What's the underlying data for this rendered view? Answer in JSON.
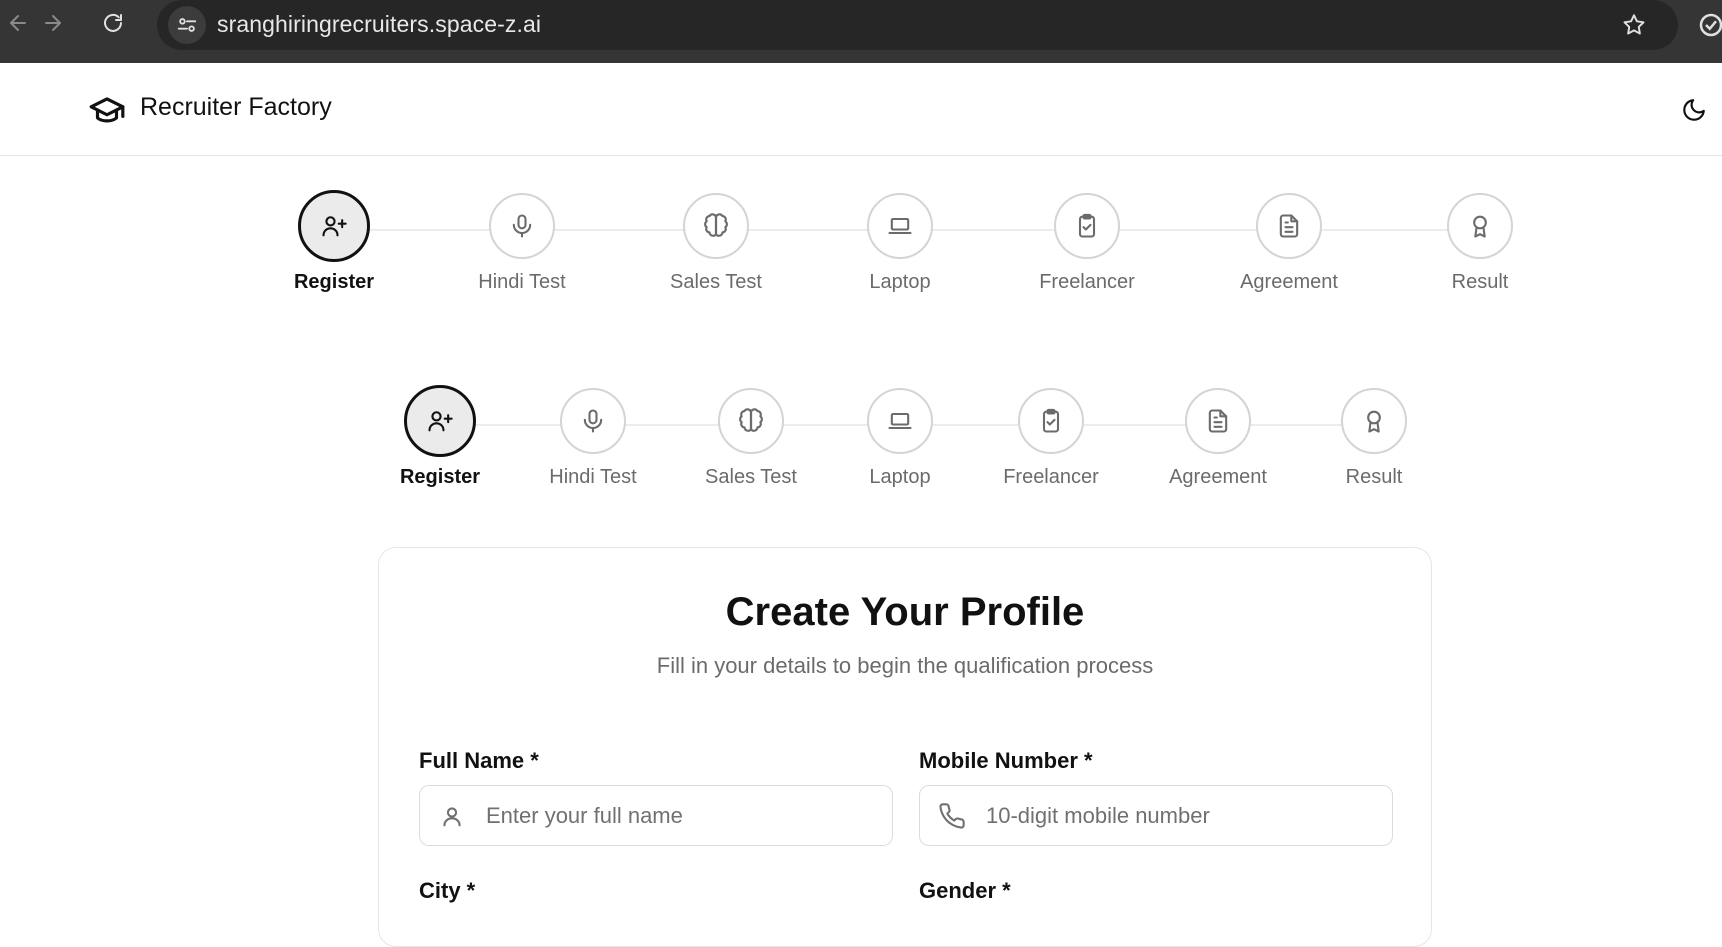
{
  "browser": {
    "url": "sranghiringrecruiters.space-z.ai"
  },
  "header": {
    "brand_name": "Recruiter Factory"
  },
  "stepper": {
    "active_index": 0,
    "steps": [
      {
        "label": "Register",
        "icon": "user-plus-icon"
      },
      {
        "label": "Hindi Test",
        "icon": "microphone-icon"
      },
      {
        "label": "Sales Test",
        "icon": "brain-icon"
      },
      {
        "label": "Laptop",
        "icon": "laptop-icon"
      },
      {
        "label": "Freelancer",
        "icon": "clipboard-check-icon"
      },
      {
        "label": "Agreement",
        "icon": "document-icon"
      },
      {
        "label": "Result",
        "icon": "award-icon"
      }
    ]
  },
  "form": {
    "title": "Create Your Profile",
    "subtitle": "Fill in your details to begin the qualification process",
    "full_name": {
      "label": "Full Name *",
      "placeholder": "Enter your full name",
      "value": ""
    },
    "mobile": {
      "label": "Mobile Number *",
      "placeholder": "10-digit mobile number",
      "value": ""
    },
    "city": {
      "label": "City *"
    },
    "gender": {
      "label": "Gender *"
    }
  }
}
